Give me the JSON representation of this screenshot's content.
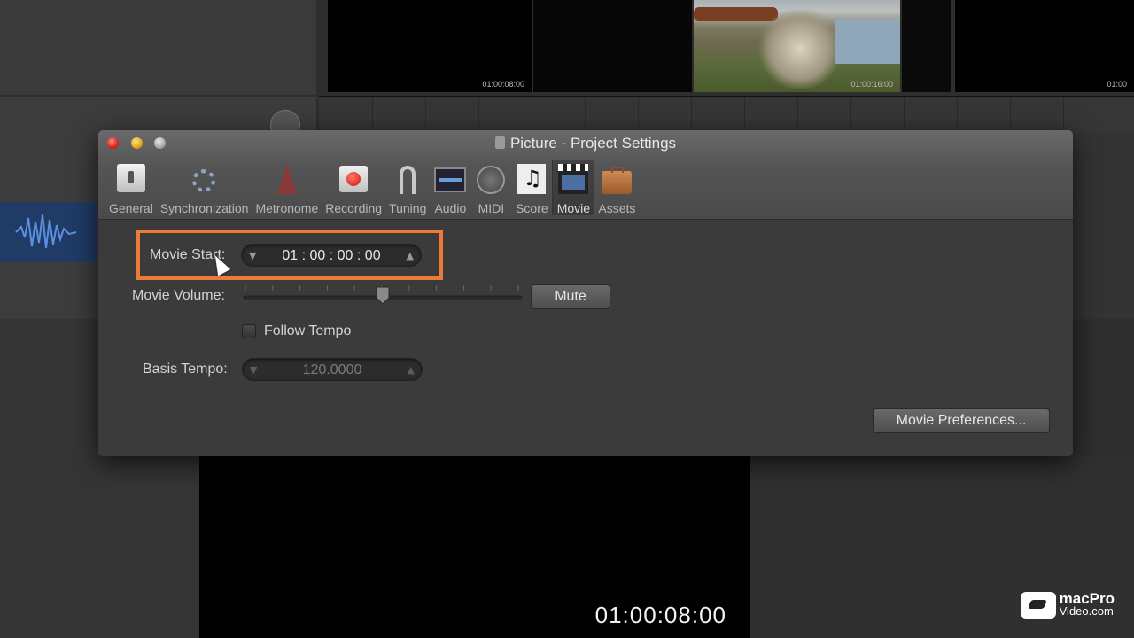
{
  "background": {
    "film_frames": [
      {
        "timecode": "01:00:08:00"
      },
      {
        "timecode": "01:00:16:00"
      },
      {
        "timecode": "01:00"
      }
    ],
    "viewer_timecode": "01:00:08:00",
    "watermark": {
      "line1": "macPro",
      "line2": "Video.com"
    }
  },
  "window": {
    "title": "Picture - Project Settings",
    "toolbar": [
      {
        "label": "General",
        "icon": "general-icon"
      },
      {
        "label": "Synchronization",
        "icon": "synchronization-icon"
      },
      {
        "label": "Metronome",
        "icon": "metronome-icon"
      },
      {
        "label": "Recording",
        "icon": "recording-icon"
      },
      {
        "label": "Tuning",
        "icon": "tuning-fork-icon"
      },
      {
        "label": "Audio",
        "icon": "audio-icon"
      },
      {
        "label": "MIDI",
        "icon": "midi-icon"
      },
      {
        "label": "Score",
        "icon": "score-icon"
      },
      {
        "label": "Movie",
        "icon": "movie-clapper-icon",
        "selected": true
      },
      {
        "label": "Assets",
        "icon": "assets-briefcase-icon"
      }
    ],
    "settings": {
      "movie_start_label": "Movie Start:",
      "movie_start_value": "01 : 00 : 00 : 00",
      "movie_volume_label": "Movie Volume:",
      "movie_volume_level": 0.5,
      "mute_label": "Mute",
      "follow_tempo_label": "Follow Tempo",
      "follow_tempo_checked": false,
      "basis_tempo_label": "Basis Tempo:",
      "basis_tempo_value": "120.0000",
      "movie_preferences_label": "Movie Preferences..."
    }
  },
  "colors": {
    "highlight": "#ee7a3a",
    "close": "#d8261c",
    "minimize": "#e3a51c"
  }
}
